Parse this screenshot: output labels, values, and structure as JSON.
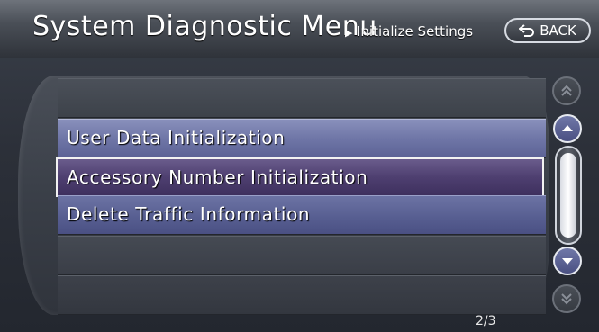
{
  "header": {
    "title": "System Diagnostic Menu",
    "breadcrumb": "Initialize Settings",
    "back_label": "BACK"
  },
  "menu": {
    "items": [
      {
        "label": ""
      },
      {
        "label": "User Data Initialization"
      },
      {
        "label": "Accessory Number Initialization",
        "selected": true
      },
      {
        "label": "Delete Traffic Information"
      },
      {
        "label": ""
      },
      {
        "label": ""
      }
    ]
  },
  "pagination": {
    "indicator": "2/3"
  },
  "scroll": {
    "thumb_position": 0.0
  }
}
